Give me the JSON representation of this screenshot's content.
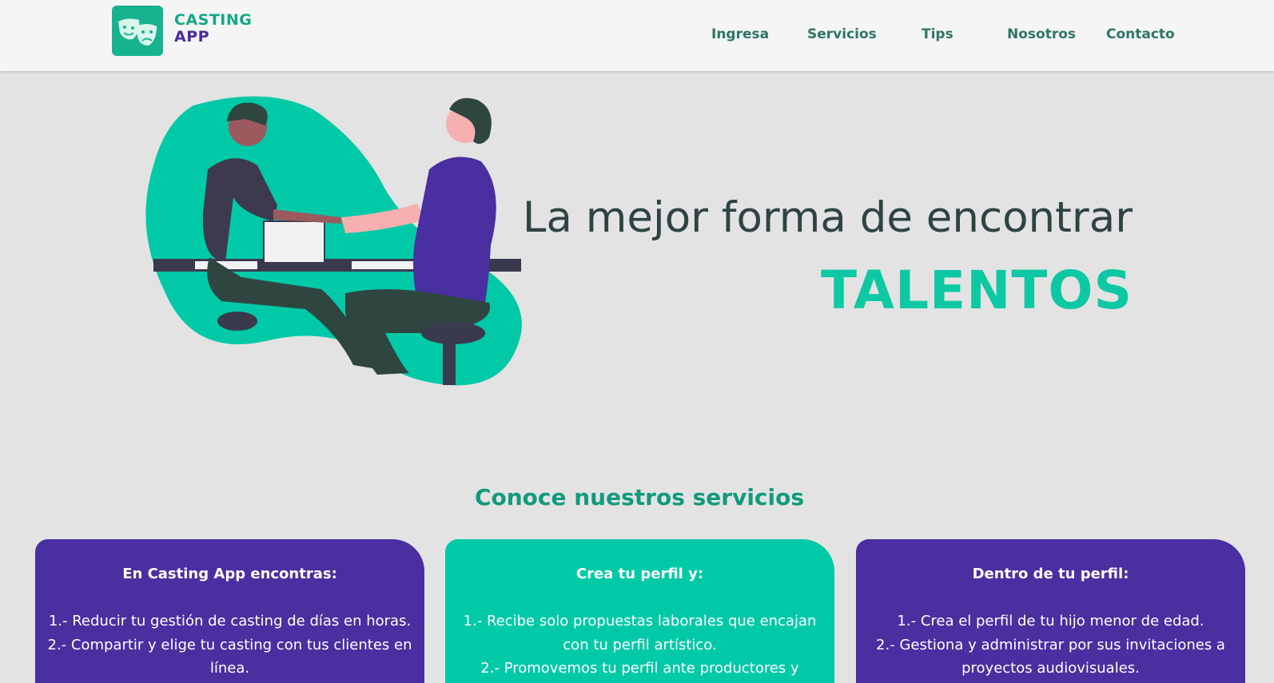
{
  "header": {
    "logo_line1": "CASTING",
    "logo_line2": "APP",
    "nav": [
      "Ingresa",
      "Servicios",
      "Tips",
      "Nosotros",
      "Contacto"
    ]
  },
  "hero": {
    "line1": "La mejor forma de encontrar",
    "line2": "TALENTOS"
  },
  "services": {
    "title": "Conoce nuestros servicios",
    "cards": [
      {
        "title": "En Casting App encontras:",
        "items": [
          "1.- Reducir tu gestión de casting de días en horas.",
          "2.- Compartir y elige tu casting con tus clientes en línea."
        ]
      },
      {
        "title": "Crea tu perfil y:",
        "items": [
          "1.- Recibe solo propuestas laborales que encajan con tu perfil artístico.",
          "2.- Promovemos tu perfil ante productores y"
        ]
      },
      {
        "title": "Dentro de tu perfil:",
        "items": [
          "1.- Crea el perfil de tu hijo menor de edad.",
          "2.- Gestiona y administrar por sus invitaciones a proyectos audiovisuales."
        ]
      }
    ]
  },
  "colors": {
    "teal": "#00c9a7",
    "purple": "#4a2fa0",
    "nav_text": "#2e7566"
  }
}
